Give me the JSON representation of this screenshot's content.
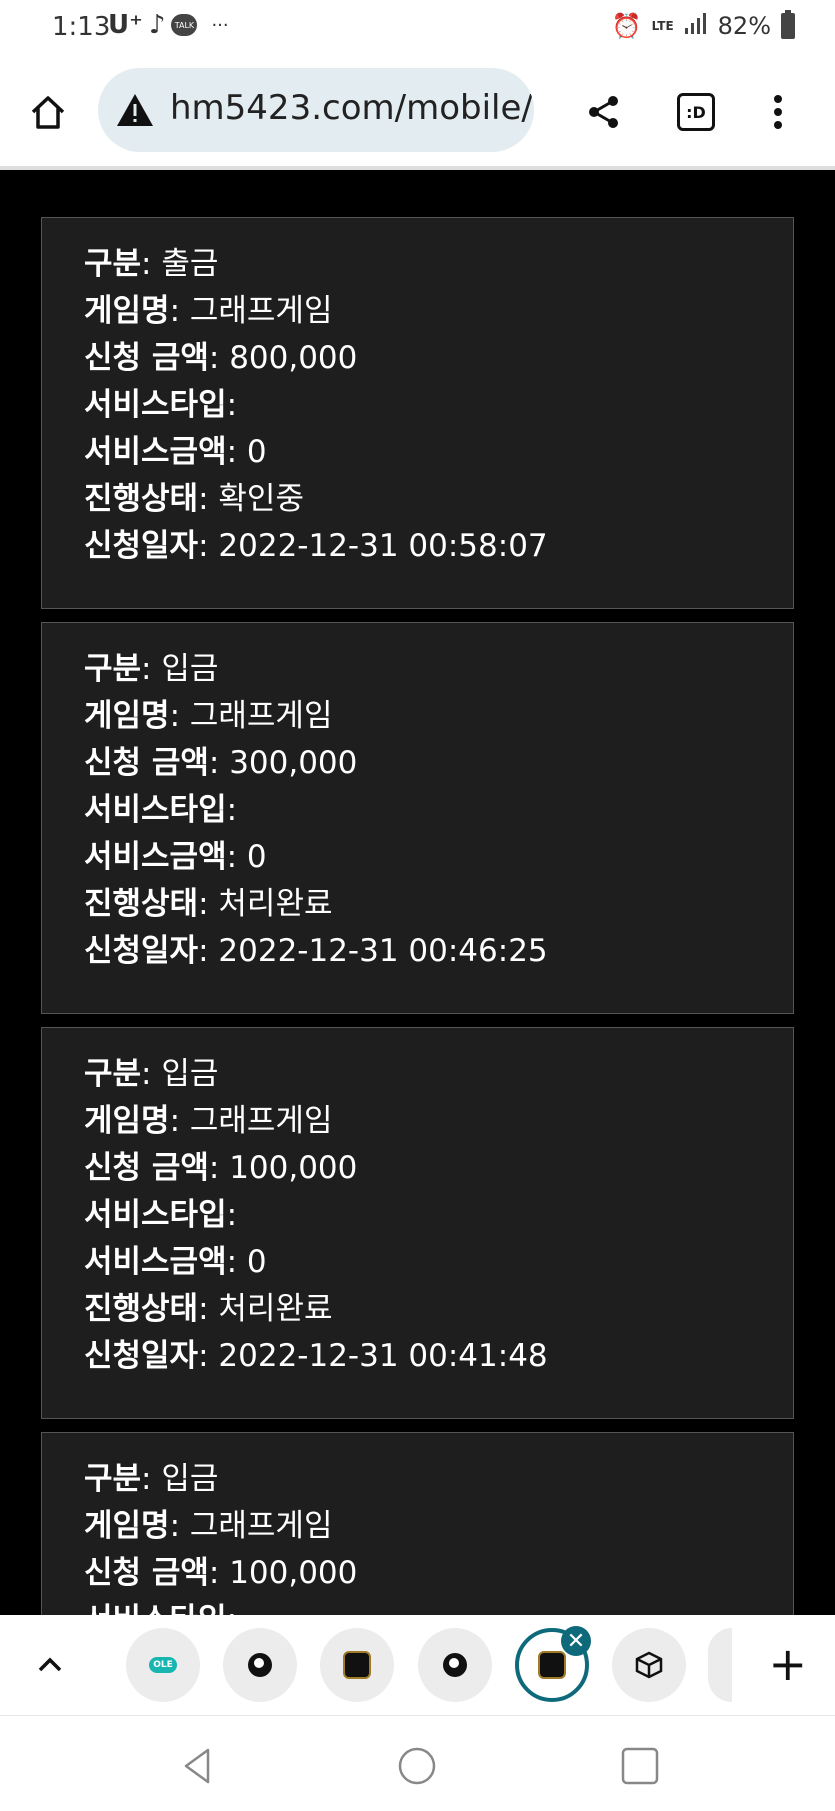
{
  "status_bar": {
    "time": "1:13",
    "carrier": "U⁺",
    "talk_badge": "TALK",
    "more": "···",
    "network": "LTE",
    "battery": "82%"
  },
  "browser": {
    "url": "hm5423.com/mobile/",
    "tab_switcher_label": ":D"
  },
  "labels": {
    "type": "구분",
    "game": "게임명",
    "amount": "신청 금액",
    "service_type": "서비스타입",
    "service_amount": "서비스금액",
    "status": "진행상태",
    "date": "신청일자"
  },
  "records": [
    {
      "type": "출금",
      "game": "그래프게임",
      "amount": "800,000",
      "service_type": "",
      "service_amount": "0",
      "status": "확인중",
      "date": "2022-12-31 00:58:07"
    },
    {
      "type": "입금",
      "game": "그래프게임",
      "amount": "300,000",
      "service_type": "",
      "service_amount": "0",
      "status": "처리완료",
      "date": "2022-12-31 00:46:25"
    },
    {
      "type": "입금",
      "game": "그래프게임",
      "amount": "100,000",
      "service_type": "",
      "service_amount": "0",
      "status": "처리완료",
      "date": "2022-12-31 00:41:48"
    },
    {
      "type": "입금",
      "game": "그래프게임",
      "amount": "100,000",
      "service_type": "",
      "service_amount": "",
      "status": "",
      "date": ""
    }
  ],
  "tabs": {
    "items": [
      "olleh",
      "globe",
      "app",
      "globe",
      "app-active",
      "package"
    ],
    "close_glyph": "✕",
    "add_glyph": "+"
  }
}
